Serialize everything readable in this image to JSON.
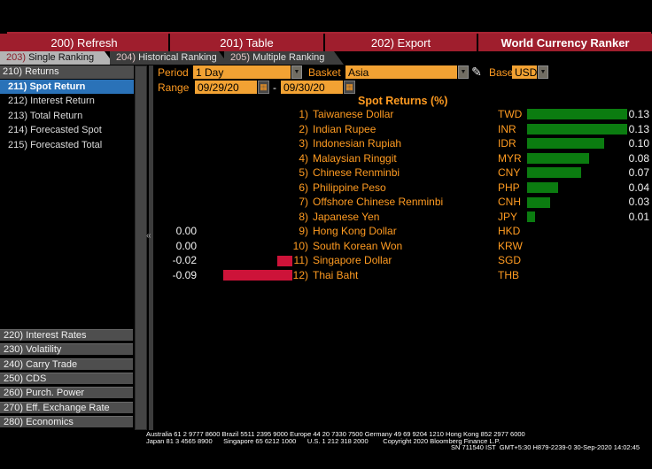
{
  "toolbar": {
    "buttons": [
      {
        "label": "200) Refresh"
      },
      {
        "label": "201) Table"
      },
      {
        "label": "202) Export"
      }
    ],
    "title": "World Currency Ranker"
  },
  "tabs": [
    {
      "num": "203)",
      "label": "Single Ranking",
      "active": true
    },
    {
      "num": "204)",
      "label": "Historical Ranking",
      "active": false
    },
    {
      "num": "205)",
      "label": "Multiple Ranking",
      "active": false
    }
  ],
  "sidebar": {
    "returns_header": "210) Returns",
    "selected_item": "211) Spot Return",
    "return_items": [
      "212) Interest Return",
      "213) Total Return",
      "214) Forecasted Spot",
      "215) Forecasted Total"
    ],
    "category_items": [
      "220) Interest Rates",
      "230) Volatility",
      "240) Carry Trade",
      "250) CDS",
      "260) Purch. Power",
      "270) Eff. Exchange Rate",
      "280) Economics"
    ],
    "collapse_glyph": "«"
  },
  "controls": {
    "period_label": "Period",
    "period_value": "1 Day",
    "basket_label": "Basket",
    "basket_value": "Asia",
    "base_label": "Base",
    "base_value": "USD",
    "range_label": "Range",
    "range_start": "09/29/20",
    "range_separator": "-",
    "range_end": "09/30/20",
    "dropdown_arrow": "▼",
    "calendar_glyph": "▦",
    "pencil_glyph": "✎"
  },
  "chart_data": {
    "type": "bar",
    "orientation": "horizontal",
    "title": "Spot Returns (%)",
    "unit": "%",
    "categories": [
      "Taiwanese Dollar",
      "Indian Rupee",
      "Indonesian Rupiah",
      "Malaysian Ringgit",
      "Chinese Renminbi",
      "Philippine Peso",
      "Offshore Chinese Renminbi",
      "Japanese Yen",
      "Hong Kong Dollar",
      "South Korean Won",
      "Singapore Dollar",
      "Thai Baht"
    ],
    "tickers": [
      "TWD",
      "INR",
      "IDR",
      "MYR",
      "CNY",
      "PHP",
      "CNH",
      "JPY",
      "HKD",
      "KRW",
      "SGD",
      "THB"
    ],
    "values": [
      0.13,
      0.13,
      0.1,
      0.08,
      0.07,
      0.04,
      0.03,
      0.01,
      0.0,
      0.0,
      -0.02,
      -0.09
    ],
    "value_labels": [
      "0.13",
      "0.13",
      "0.10",
      "0.08",
      "0.07",
      "0.04",
      "0.03",
      "0.01",
      "0.00",
      "0.00",
      "-0.02",
      "-0.09"
    ],
    "positive_color": "#0b7c10",
    "negative_color": "#cd1339",
    "legend": "none",
    "grid": false
  },
  "footer": {
    "line1": "Australia 61 2 9777 8600 Brazil 5511 2395 9000 Europe 44 20 7330 7500 Germany 49 69 9204 1210 Hong Kong 852 2977 6000",
    "line2": "Japan 81 3 4565 8900      Singapore 65 6212 1000      U.S. 1 212 318 2000        Copyright 2020 Bloomberg Finance L.P.",
    "line3": "SN 711540 IST  GMT+5:30 H879-2239-0 30-Sep-2020 14:02:45"
  }
}
